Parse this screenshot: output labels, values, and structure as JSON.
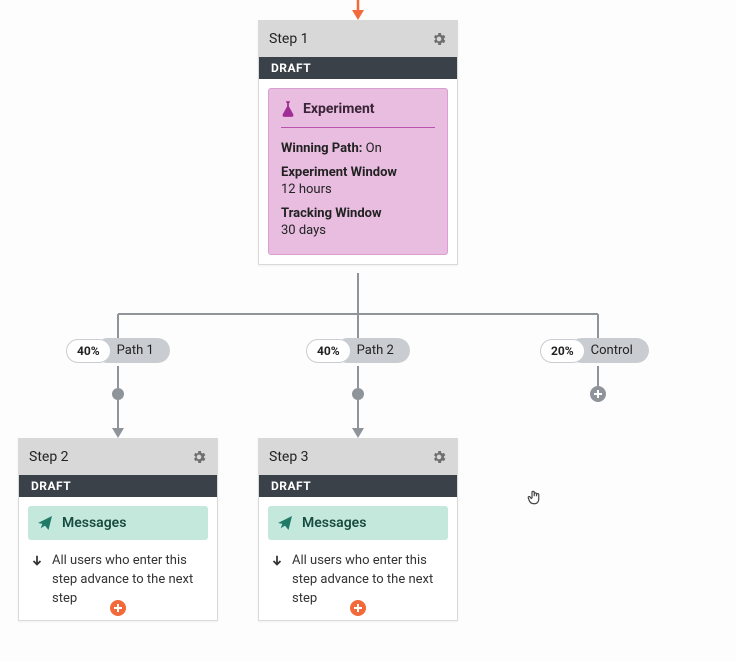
{
  "steps": {
    "step1": {
      "title": "Step 1",
      "status": "DRAFT",
      "experiment": {
        "heading": "Experiment",
        "winning_label": "Winning Path:",
        "winning_value": "On",
        "exp_window_label": "Experiment Window",
        "exp_window_value": "12 hours",
        "track_window_label": "Tracking Window",
        "track_window_value": "30 days"
      }
    },
    "step2": {
      "title": "Step 2",
      "status": "DRAFT",
      "messages_label": "Messages",
      "advance_text": "All users who enter this step advance to the next step"
    },
    "step3": {
      "title": "Step 3",
      "status": "DRAFT",
      "messages_label": "Messages",
      "advance_text": "All users who enter this step advance to the next step"
    }
  },
  "paths": {
    "p1": {
      "pct": "40%",
      "label": "Path 1"
    },
    "p2": {
      "pct": "40%",
      "label": "Path 2"
    },
    "p3": {
      "pct": "20%",
      "label": "Control"
    }
  }
}
